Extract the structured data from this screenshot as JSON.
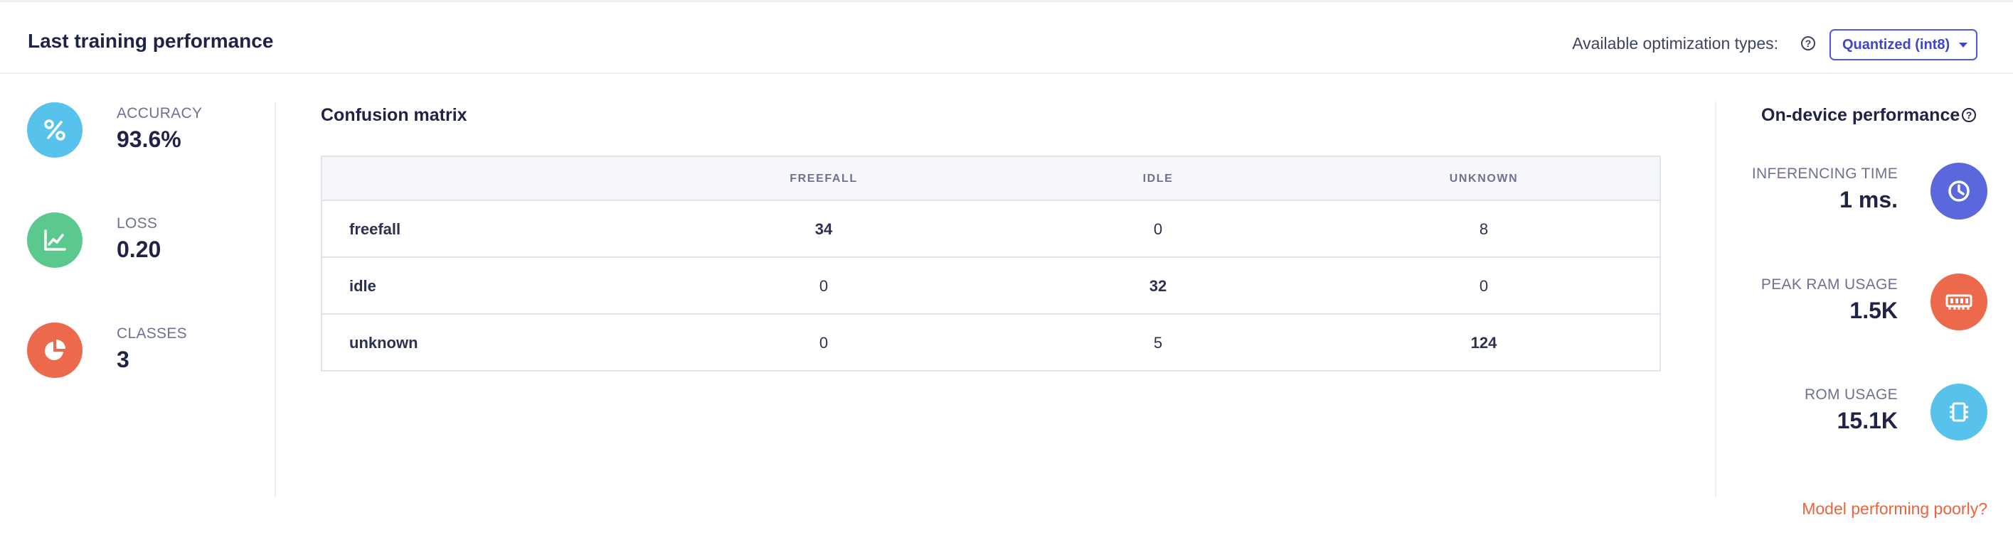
{
  "header": {
    "title": "Last training performance",
    "optimization_label": "Available optimization types:",
    "optimization_selected": "Quantized (int8)"
  },
  "metrics": [
    {
      "label": "ACCURACY",
      "value": "93.6%",
      "icon": "percent-icon",
      "color": "#57c3ec"
    },
    {
      "label": "LOSS",
      "value": "0.20",
      "icon": "chart-line-icon",
      "color": "#5bc98e"
    },
    {
      "label": "CLASSES",
      "value": "3",
      "icon": "pie-chart-icon",
      "color": "#ec6a4b"
    }
  ],
  "confusion_matrix": {
    "title": "Confusion matrix",
    "columns": [
      "FREEFALL",
      "IDLE",
      "UNKNOWN"
    ],
    "rows": [
      {
        "label": "freefall",
        "values": [
          "34",
          "0",
          "8"
        ]
      },
      {
        "label": "idle",
        "values": [
          "0",
          "32",
          "0"
        ]
      },
      {
        "label": "unknown",
        "values": [
          "0",
          "5",
          "124"
        ]
      }
    ]
  },
  "performance": {
    "title": "On-device performance",
    "items": [
      {
        "label": "INFERENCING TIME",
        "value": "1 ms.",
        "icon": "clock-icon",
        "color": "#5b68dc"
      },
      {
        "label": "PEAK RAM USAGE",
        "value": "1.5K",
        "icon": "memory-icon",
        "color": "#ec6a4b"
      },
      {
        "label": "ROM USAGE",
        "value": "15.1K",
        "icon": "chip-icon",
        "color": "#57c3ec"
      }
    ]
  },
  "footer": {
    "poor_link": "Model performing poorly?"
  }
}
